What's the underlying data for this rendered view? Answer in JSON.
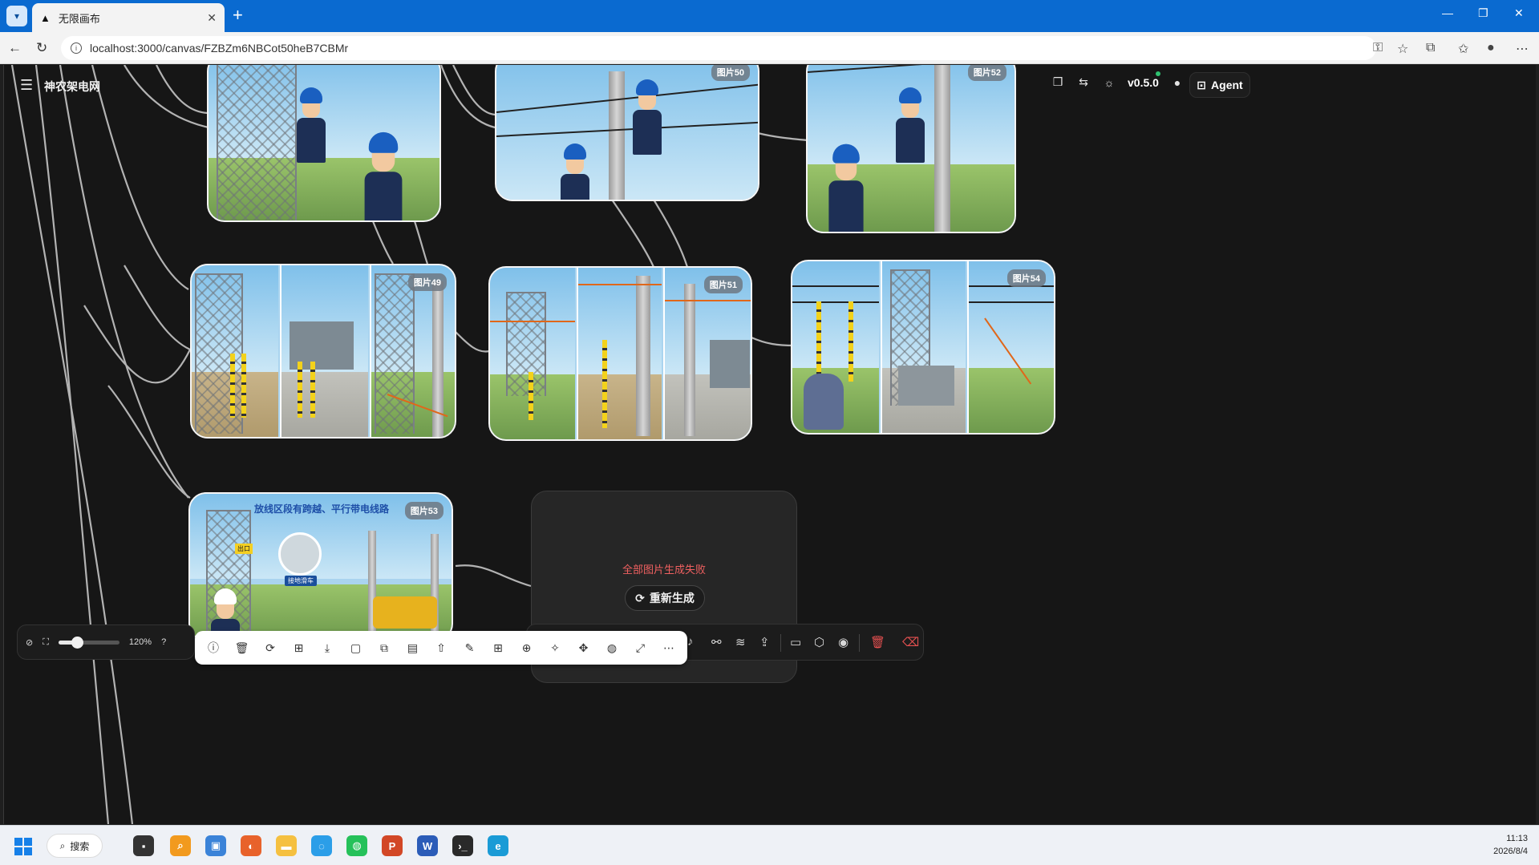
{
  "browser": {
    "tab_title": "无限画布",
    "url": "localhost:3000/canvas/FZBZm6NBCot50heB7CBMr"
  },
  "app": {
    "title": "神农架电网",
    "version": "v0.5.0",
    "agent_label": "Agent"
  },
  "nodes": [
    {
      "badge": "图片50"
    },
    {
      "badge": "图片52"
    },
    {
      "badge": "图片49"
    },
    {
      "badge": "图片51"
    },
    {
      "badge": "图片54"
    },
    {
      "badge": "图片53",
      "caption": "放线区段有跨越、平行带电线路",
      "label_a": "出口",
      "label_b": "接地滑车"
    }
  ],
  "fail_card": {
    "message": "全部图片生成失败",
    "regen_label": "重新生成"
  },
  "zoom": {
    "level": "120%",
    "fraction": 0.3
  },
  "taskbar": {
    "search_label": "搜索",
    "time": "11:13",
    "date": "2026/8/4"
  },
  "colors": {
    "tabbar": "#0a6ad0",
    "canvas": "#161616",
    "error": "#f06060",
    "delete": "#e45050"
  }
}
